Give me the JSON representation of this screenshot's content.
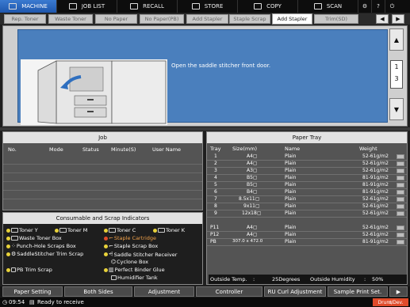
{
  "top_tabs": [
    {
      "label": "MACHINE",
      "icon": "machine-icon",
      "active": true
    },
    {
      "label": "JOB LIST",
      "icon": "job-list-icon",
      "active": false
    },
    {
      "label": "RECALL",
      "icon": "recall-icon",
      "active": false
    },
    {
      "label": "STORE",
      "icon": "store-icon",
      "active": false
    },
    {
      "label": "COPY",
      "icon": "copy-icon",
      "active": false
    },
    {
      "label": "SCAN",
      "icon": "scan-icon",
      "active": false
    }
  ],
  "sub_tabs": [
    "Rep. Toner",
    "Waste Toner",
    "No Paper",
    "No Paper(PB)",
    "Add Stapler",
    "Staple Scrap",
    "Add Stapler",
    "Trim(SD)"
  ],
  "active_sub_tab": "Add Stapler",
  "message": "Open the saddle stitcher front door.",
  "pager": {
    "current": "1",
    "total": "3"
  },
  "job_panel": {
    "title": "Job",
    "columns": [
      "No.",
      "Mode",
      "Status",
      "Minute(S)",
      "User Name"
    ]
  },
  "consumables": {
    "title": "Consumable and Scrap Indicators",
    "items": {
      "toner_y": "Toner Y",
      "toner_m": "Toner M",
      "toner_c": "Toner C",
      "toner_k": "Toner K",
      "waste_toner": "Waste Toner Box",
      "staple_cartridge": "Staple Cartridge",
      "punch_hole": "Punch-Hole Scraps Box",
      "staple_scrap": "Staple Scrap Box",
      "saddle_trim": "SaddleStitcher Trim Scrap",
      "saddle_receiver": "Saddle Stitcher Receiver",
      "cyclone": "Cyclone Box",
      "pb_trim": "PB Trim Scrap",
      "binder_glue": "Perfect Binder Glue",
      "humidifier": "Humidifier Tank"
    }
  },
  "paper_tray": {
    "title": "Paper Tray",
    "columns": {
      "tray": "Tray",
      "size": "Size(mm)",
      "name": "Name",
      "weight": "Weight"
    },
    "rows": [
      {
        "tray": "1",
        "size": "A4▢",
        "name": "Plain",
        "weight": "52-61g/m2"
      },
      {
        "tray": "2",
        "size": "A4▢",
        "name": "Plain",
        "weight": "52-61g/m2"
      },
      {
        "tray": "3",
        "size": "A3▢",
        "name": "Plain",
        "weight": "52-61g/m2"
      },
      {
        "tray": "4",
        "size": "B5▢",
        "name": "Plain",
        "weight": "81-91g/m2"
      },
      {
        "tray": "5",
        "size": "B5▢",
        "name": "Plain",
        "weight": "81-91g/m2"
      },
      {
        "tray": "6",
        "size": "B4▢",
        "name": "Plain",
        "weight": "81-91g/m2"
      },
      {
        "tray": "7",
        "size": "8.5x11▢",
        "name": "Plain",
        "weight": "52-61g/m2"
      },
      {
        "tray": "8",
        "size": "9x11▢",
        "name": "Plain",
        "weight": "52-61g/m2"
      },
      {
        "tray": "9",
        "size": "12x18▢",
        "name": "Plain",
        "weight": "52-61g/m2"
      },
      {
        "tray": "P11",
        "size": "A4▢",
        "name": "Plain",
        "weight": "52-61g/m2"
      },
      {
        "tray": "P12",
        "size": "A4▢",
        "name": "Plain",
        "weight": "52-61g/m2"
      },
      {
        "tray": "PB",
        "size": "307.0 x 472.0",
        "name": "Plain",
        "weight": "81-91g/m2"
      }
    ],
    "outside_temp_label": "Outside Temp.",
    "outside_temp_value": "25Degrees",
    "outside_humidity_label": "Outside Humidity",
    "outside_humidity_value": "50%"
  },
  "bottom_buttons": [
    "Paper Setting",
    "Both Sides",
    "Adjustment",
    "Controller",
    "RU Curl Adjustment",
    "Sample Print Set."
  ],
  "status": {
    "time": "09:54",
    "text": "Ready to receive",
    "alert": "Drum/Dev."
  }
}
